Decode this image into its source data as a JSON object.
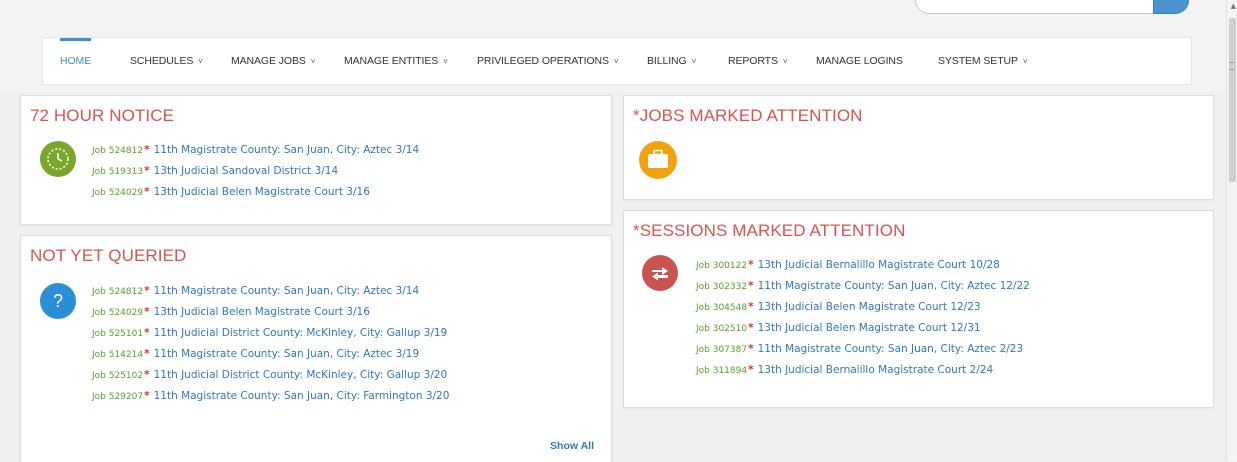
{
  "nav": {
    "items": [
      {
        "label": "HOME",
        "dropdown": false
      },
      {
        "label": "SCHEDULES",
        "dropdown": true
      },
      {
        "label": "MANAGE JOBS",
        "dropdown": true
      },
      {
        "label": "MANAGE ENTITIES",
        "dropdown": true
      },
      {
        "label": "PRIVILEGED OPERATIONS",
        "dropdown": true
      },
      {
        "label": "BILLING",
        "dropdown": true
      },
      {
        "label": "REPORTS",
        "dropdown": true
      },
      {
        "label": "MANAGE LOGINS",
        "dropdown": false
      },
      {
        "label": "SYSTEM SETUP",
        "dropdown": true
      }
    ],
    "chevron": "˅"
  },
  "panels": {
    "notice72": {
      "title": "72 HOUR NOTICE",
      "icon": "clock-icon",
      "rows": [
        {
          "job": "Job 524812",
          "desc": "11th Magistrate County: San Juan, City: Aztec 3/14"
        },
        {
          "job": "Job 519313",
          "desc": "13th Judicial Sandoval District 3/14"
        },
        {
          "job": "Job 524029",
          "desc": "13th Judicial Belen Magistrate Court 3/16"
        }
      ]
    },
    "jobs_attention": {
      "title": "*JOBS MARKED ATTENTION",
      "icon": "briefcase-icon"
    },
    "not_queried": {
      "title": "NOT YET QUERIED",
      "icon": "question-icon",
      "icon_glyph": "?",
      "rows": [
        {
          "job": "Job 524812",
          "desc": "11th Magistrate County: San Juan, City: Aztec 3/14"
        },
        {
          "job": "Job 524029",
          "desc": "13th Judicial Belen Magistrate Court 3/16"
        },
        {
          "job": "Job 525101",
          "desc": "11th Judicial District County: McKinley, City: Gallup 3/19"
        },
        {
          "job": "Job 514214",
          "desc": "11th Magistrate County: San Juan, City: Aztec 3/19"
        },
        {
          "job": "Job 525102",
          "desc": "11th Judicial District County: McKinley, City: Gallup 3/20"
        },
        {
          "job": "Job 529207",
          "desc": "11th Magistrate County: San Juan, City: Farmington 3/20"
        }
      ],
      "show_all": "Show All"
    },
    "sessions_attention": {
      "title": "*SESSIONS MARKED ATTENTION",
      "icon": "exchange-icon",
      "rows": [
        {
          "job": "Job 300122",
          "desc": "13th Judicial Bernalillo Magistrate Court 10/28"
        },
        {
          "job": "Job 302332",
          "desc": "11th Magistrate County: San Juan, City: Aztec 12/22"
        },
        {
          "job": "Job 304548",
          "desc": "13th Judicial Belen Magistrate Court 12/23"
        },
        {
          "job": "Job 302510",
          "desc": "13th Judicial Belen Magistrate Court 12/31"
        },
        {
          "job": "Job 307387",
          "desc": "11th Magistrate County: San Juan, City: Aztec 2/23"
        },
        {
          "job": "Job 311894",
          "desc": "13th Judicial Bernalillo Magistrate Court 2/24"
        }
      ]
    }
  },
  "required_marker": "*",
  "colors": {
    "accent": "#3b8fd1",
    "title_red": "#d9534f",
    "job_green": "#5aa02c",
    "link_blue": "#2f78bd",
    "clock_green": "#7aa62a",
    "question_blue": "#2a8fd6",
    "briefcase_orange": "#f2a20f",
    "exchange_red": "#c9534f"
  }
}
